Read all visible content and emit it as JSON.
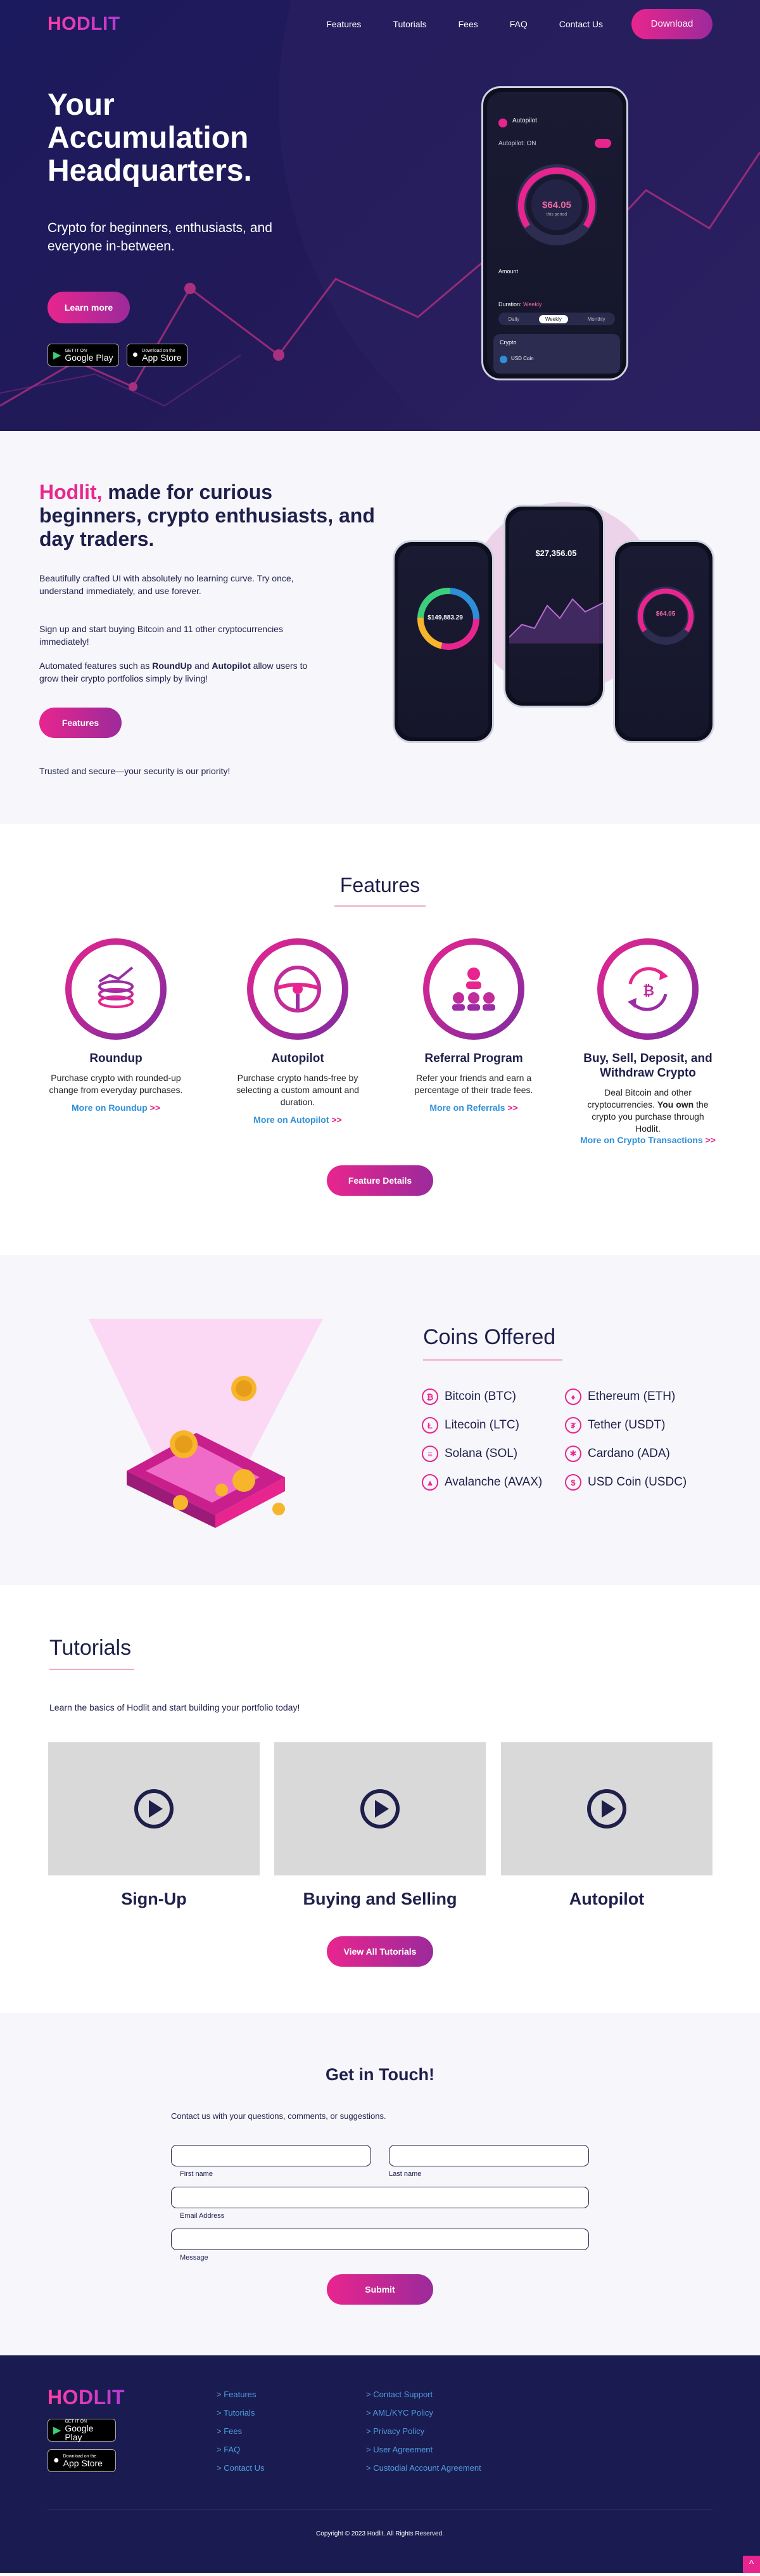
{
  "nav": {
    "logo": "HODLIT",
    "links": [
      "Features",
      "Tutorials",
      "Fees",
      "FAQ",
      "Contact Us"
    ],
    "download": "Download"
  },
  "hero": {
    "title": "Your Accumulation Headquarters.",
    "subtitle": "Crypto for beginners, enthusiasts, and everyone in-between.",
    "learn_more": "Learn more",
    "google_play": {
      "small": "GET IT ON",
      "big": "Google Play"
    },
    "app_store": {
      "small": "Download on the",
      "big": "App Store"
    },
    "phone": {
      "app": "Autopilot",
      "toggle_label": "Autopilot: ON",
      "gauge_value": "$64.05",
      "gauge_caption": "this period",
      "amount_label": "Amount",
      "duration_label": "Duration:",
      "duration_value": "Weekly",
      "segments": [
        "Daily",
        "Weekly",
        "Monthly"
      ],
      "crypto_label": "Crypto",
      "coin": "USD Coin"
    }
  },
  "intro": {
    "brand": "Hodlit,",
    "title_rest": " made for curious beginners, crypto enthusiasts, and day traders.",
    "p1": "Beautifully crafted UI with absolutely no learning curve. Try once, understand immediately, and use forever.",
    "p2": "Sign up and start buying Bitcoin and 11 other cryptocurrencies immediately!",
    "p3_a": "Automated features such as ",
    "p3_roundup": "RoundUp",
    "p3_and": " and ",
    "p3_autopilot": "Autopilot",
    "p3_b": " allow users to grow their crypto portfolios simply by living!",
    "button": "Features",
    "trust": "Trusted and secure—your security is our priority!",
    "phones": {
      "balance1": "$149,883.29",
      "balance2": "$27,356.05",
      "gauge3": "$64.05"
    }
  },
  "features": {
    "title": "Features",
    "items": [
      {
        "title": "Roundup",
        "desc": "Purchase crypto with rounded-up change from everyday purchases.",
        "more": "More on Roundup",
        "icon": "coins-stack-icon"
      },
      {
        "title": "Autopilot",
        "desc": "Purchase crypto hands-free by selecting a custom amount and duration.",
        "more": "More on Autopilot",
        "icon": "steering-wheel-icon"
      },
      {
        "title": "Referral Program",
        "desc": "Refer your friends and earn a percentage of their trade fees.",
        "more": "More on Referrals",
        "icon": "people-network-icon"
      },
      {
        "title": "Buy, Sell, Deposit, and Withdraw Crypto",
        "desc_a": "Deal Bitcoin and other cryptocurrencies. ",
        "desc_bold": "You own",
        "desc_b": " the crypto you purchase through Hodlit.",
        "more": "More on Crypto Transactions",
        "icon": "crypto-exchange-icon"
      }
    ],
    "arrows": ">>",
    "button": "Feature Details"
  },
  "coins": {
    "title": "Coins Offered",
    "list": [
      {
        "name": "Bitcoin (BTC)",
        "sym": "₿"
      },
      {
        "name": "Ethereum (ETH)",
        "sym": "♦"
      },
      {
        "name": "Litecoin (LTC)",
        "sym": "Ł"
      },
      {
        "name": "Tether (USDT)",
        "sym": "₮"
      },
      {
        "name": "Solana (SOL)",
        "sym": "≡"
      },
      {
        "name": "Cardano (ADA)",
        "sym": "✱"
      },
      {
        "name": "Avalanche (AVAX)",
        "sym": "▲"
      },
      {
        "name": "USD Coin (USDC)",
        "sym": "$"
      }
    ]
  },
  "tutorials": {
    "title": "Tutorials",
    "intro": "Learn the basics of Hodlit and start building your portfolio today!",
    "videos": [
      "Sign-Up",
      "Buying and Selling",
      "Autopilot"
    ],
    "button": "View All Tutorials"
  },
  "contact": {
    "title": "Get in Touch!",
    "intro": "Contact us with your questions, comments, or suggestions.",
    "first_name": "First name",
    "last_name": "Last name",
    "email": "Email Address",
    "message": "Message",
    "submit": "Submit"
  },
  "footer": {
    "logo": "HODLIT",
    "col1": [
      "> Features",
      "> Tutorials",
      "> Fees",
      "> FAQ",
      "> Contact Us"
    ],
    "col2": [
      "> Contact Support",
      "> AML/KYC Policy",
      "> Privacy Policy",
      "> User Agreement",
      "> Custodial Account Agreement"
    ],
    "copyright": "Copyright © 2023 Hodlit. All Rights Reserved.",
    "to_top": "^"
  },
  "colors": {
    "accent": "#e8288f",
    "navy": "#1a1b50",
    "link": "#2d8fd8"
  }
}
